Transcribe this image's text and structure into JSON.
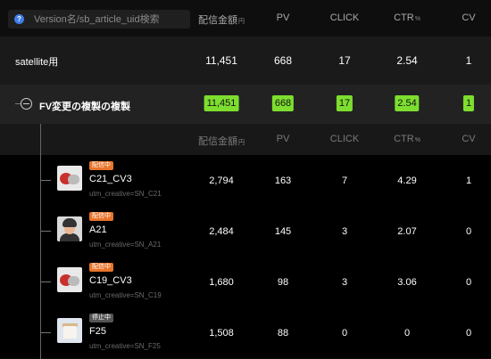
{
  "header": {
    "search_placeholder": "Version名/sb_article_uid検索",
    "help_icon": "?",
    "columns": {
      "amount": "配信金額",
      "amount_unit": "円",
      "pv": "PV",
      "click": "CLICK",
      "ctr": "CTR",
      "ctr_unit": "%",
      "cv": "CV"
    }
  },
  "satellite": {
    "name": "satellite用",
    "amount": "11,451",
    "pv": "668",
    "click": "17",
    "ctr": "2.54",
    "cv": "1"
  },
  "fv": {
    "name": "FV変更の複製の複製",
    "amount": "11,451",
    "pv": "668",
    "click": "17",
    "ctr": "2.54",
    "cv": "1",
    "highlight_color": "#7dde2f"
  },
  "sub_header": {
    "amount": "配信金額",
    "amount_unit": "円",
    "pv": "PV",
    "click": "CLICK",
    "ctr": "CTR",
    "ctr_unit": "%",
    "cv": "CV"
  },
  "items": [
    {
      "status": "配信中",
      "name": "C21_CV3",
      "utm": "utm_creative=SN_C21",
      "thumb_icon": "shoe-thumbnail",
      "amount": "2,794",
      "pv": "163",
      "click": "7",
      "ctr": "4.29",
      "cv": "1"
    },
    {
      "status": "配信中",
      "name": "A21",
      "utm": "utm_creative=SN_A21",
      "thumb_icon": "person-thumbnail",
      "amount": "2,484",
      "pv": "145",
      "click": "3",
      "ctr": "2.07",
      "cv": "0"
    },
    {
      "status": "配信中",
      "name": "C19_CV3",
      "utm": "utm_creative=SN_C19",
      "thumb_icon": "shoe-thumbnail",
      "amount": "1,680",
      "pv": "98",
      "click": "3",
      "ctr": "3.06",
      "cv": "0"
    },
    {
      "status": "停止中",
      "name": "F25",
      "utm": "utm_creative=SN_F25",
      "thumb_icon": "cream-jar-thumbnail",
      "amount": "1,508",
      "pv": "88",
      "click": "0",
      "ctr": "0",
      "cv": "0"
    }
  ],
  "colors": {
    "live_badge": "#e8742a",
    "stopped_badge": "#555555",
    "help_icon": "#3f7de8"
  }
}
